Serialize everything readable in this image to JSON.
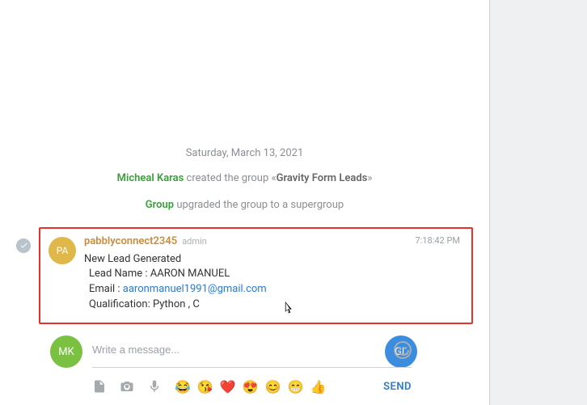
{
  "date": "Saturday, March 13, 2021",
  "system_messages": {
    "creator": "Micheal Karas",
    "created_text": " created the group «",
    "group_name": "Gravity Form Leads",
    "created_close": "»",
    "group_label": "Group",
    "upgraded_text": " upgraded the group to a supergroup"
  },
  "message": {
    "avatar_initials": "PA",
    "sender": "pabblyconnect2345",
    "badge": "admin",
    "timestamp": "7:18:42 PM",
    "line1": "New Lead Generated",
    "lead_label": "Lead Name : ",
    "lead_name": "AARON MANUEL",
    "email_label": "Email : ",
    "email": "aaronmanuel1991@gmail.com",
    "qual_label": "Qualification: ",
    "qual": "Python , C"
  },
  "composer": {
    "placeholder": "Write a message...",
    "send": "SEND"
  },
  "self_avatar": "MK",
  "right_avatar": "GL",
  "emojis": {
    "e1": "😂",
    "e2": "😘",
    "e3": "❤️",
    "e4": "😍",
    "e5": "😊",
    "e6": "😁",
    "e7": "👍"
  }
}
